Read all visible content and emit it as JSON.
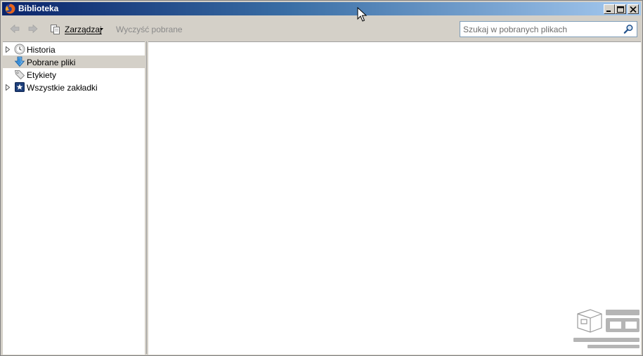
{
  "window": {
    "title": "Biblioteka"
  },
  "toolbar": {
    "organize_label": "Zarządzaj",
    "clear_downloads_label": "Wyczyść pobrane"
  },
  "search": {
    "placeholder": "Szukaj w pobranych plikach",
    "value": ""
  },
  "sidebar": {
    "items": [
      {
        "label": "Historia",
        "icon": "history-clock-icon",
        "expandable": true,
        "selected": false
      },
      {
        "label": "Pobrane pliki",
        "icon": "download-arrow-icon",
        "expandable": false,
        "selected": true
      },
      {
        "label": "Etykiety",
        "icon": "tag-icon",
        "expandable": false,
        "selected": false
      },
      {
        "label": "Wszystkie zakładki",
        "icon": "bookmarks-star-icon",
        "expandable": true,
        "selected": false
      }
    ]
  },
  "colors": {
    "titlebar_start": "#0a246a",
    "titlebar_end": "#a6caf0",
    "chrome": "#d4d0c8",
    "selection": "#d4d0c8"
  }
}
